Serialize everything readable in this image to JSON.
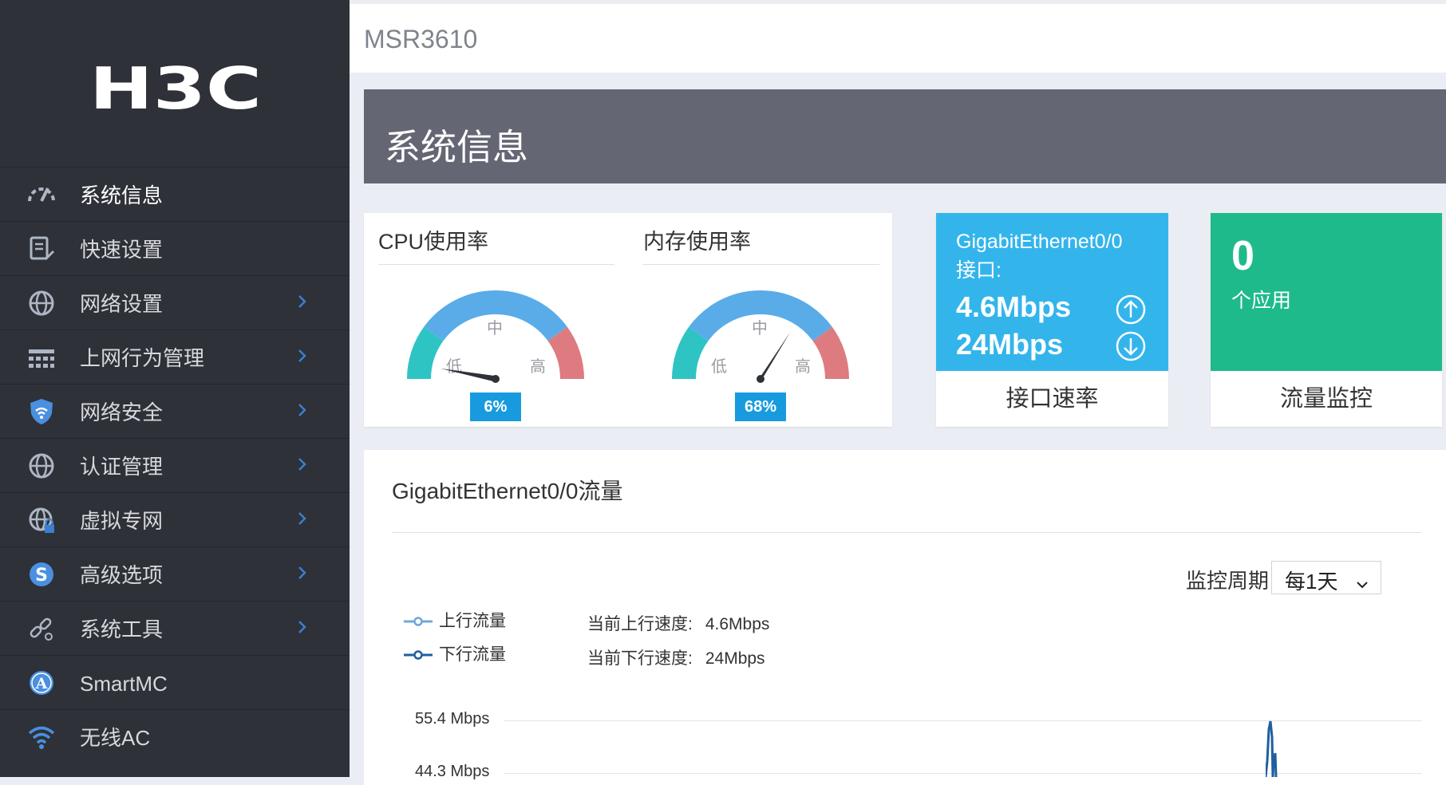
{
  "sidebar": {
    "logo_text": "H3C",
    "items": [
      {
        "label": "系统信息",
        "icon": "dashboard-gauge-icon",
        "active": true,
        "has_submenu": false
      },
      {
        "label": "快速设置",
        "icon": "quick-setup-clipboard-icon",
        "active": false,
        "has_submenu": false
      },
      {
        "label": "网络设置",
        "icon": "globe-icon",
        "active": false,
        "has_submenu": true
      },
      {
        "label": "上网行为管理",
        "icon": "network-tree-icon",
        "active": false,
        "has_submenu": true
      },
      {
        "label": "网络安全",
        "icon": "shield-wifi-icon",
        "active": false,
        "has_submenu": true
      },
      {
        "label": "认证管理",
        "icon": "globe-icon",
        "active": false,
        "has_submenu": true
      },
      {
        "label": "虚拟专网",
        "icon": "globe-lock-icon",
        "active": false,
        "has_submenu": true
      },
      {
        "label": "高级选项",
        "icon": "advanced-s-icon",
        "active": false,
        "has_submenu": true
      },
      {
        "label": "系统工具",
        "icon": "tools-link-icon",
        "active": false,
        "has_submenu": true
      },
      {
        "label": "SmartMC",
        "icon": "smartmc-a-icon",
        "active": false,
        "has_submenu": false
      },
      {
        "label": "无线AC",
        "icon": "wifi-icon",
        "active": false,
        "has_submenu": false
      }
    ]
  },
  "header": {
    "device_name": "MSR3610"
  },
  "banner": {
    "title": "系统信息"
  },
  "gauges": [
    {
      "title": "CPU使用率",
      "percent": 6,
      "display": "6%",
      "low": "低",
      "mid": "中",
      "high": "高"
    },
    {
      "title": "内存使用率",
      "percent": 68,
      "display": "68%",
      "low": "低",
      "mid": "中",
      "high": "高"
    }
  ],
  "interface_card": {
    "interface": "GigabitEthernet0/0",
    "suffix": "接口:",
    "up_speed": "4.6Mbps",
    "down_speed": "24Mbps",
    "footer": "接口速率"
  },
  "app_card": {
    "count": "0",
    "unit": "个应用",
    "footer": "流量监控"
  },
  "traffic": {
    "title": "GigabitEthernet0/0流量",
    "period_label": "监控周期",
    "period_value": "每1天",
    "legend": [
      {
        "label": "上行流量",
        "color": "#6fa8dc"
      },
      {
        "label": "下行流量",
        "color": "#1f5f9f"
      }
    ],
    "current_up_label": "当前上行速度:",
    "current_up_value": "4.6Mbps",
    "current_down_label": "当前下行速度:",
    "current_down_value": "24Mbps",
    "y_ticks": [
      "55.4 Mbps",
      "44.3 Mbps"
    ]
  },
  "colors": {
    "sidebar_bg": "#2e3138",
    "banner_bg": "#646773",
    "interface_card": "#33b5ec",
    "app_card": "#1fba8c",
    "gauge_low": "#2ec4c4",
    "gauge_mid": "#5aace8",
    "gauge_high": "#dd7b80",
    "badge": "#189bde"
  }
}
